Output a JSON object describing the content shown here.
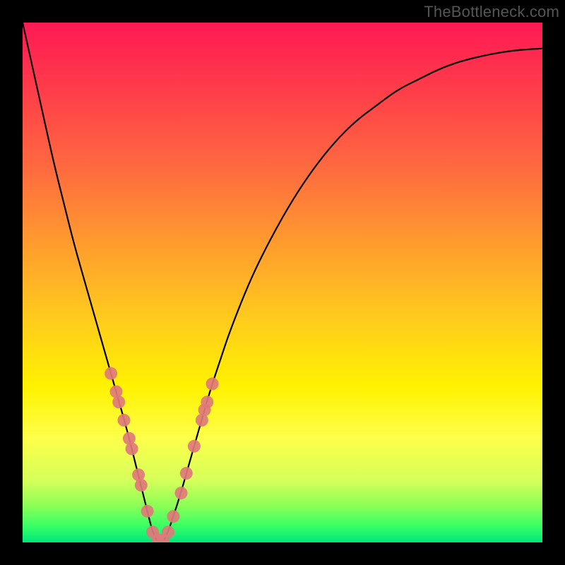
{
  "watermark": "TheBottleneck.com",
  "chart_data": {
    "type": "line",
    "title": "",
    "xlabel": "",
    "ylabel": "",
    "xlim": [
      0,
      100
    ],
    "ylim": [
      0,
      100
    ],
    "series": [
      {
        "name": "bottleneck-curve",
        "x": [
          0,
          2,
          4,
          6,
          8,
          10,
          12,
          14,
          16,
          18,
          20,
          22,
          24,
          25,
          26,
          27,
          28,
          30,
          32,
          34,
          36,
          38,
          40,
          44,
          48,
          52,
          56,
          60,
          64,
          68,
          72,
          76,
          80,
          84,
          88,
          92,
          96,
          100
        ],
        "y": [
          100,
          91,
          82,
          73,
          65,
          57,
          50,
          43,
          36,
          29,
          22,
          14,
          6,
          2,
          0,
          0,
          2,
          8,
          15,
          22,
          29,
          35,
          41,
          51,
          59,
          66,
          72,
          77,
          81,
          84,
          87,
          89,
          91,
          92.5,
          93.5,
          94.3,
          94.8,
          95
        ]
      }
    ],
    "markers": {
      "name": "curve-dots",
      "color": "#e07a7a",
      "points": [
        {
          "x": 17.0,
          "y": 32.5
        },
        {
          "x": 18.0,
          "y": 29.0
        },
        {
          "x": 18.5,
          "y": 27.0
        },
        {
          "x": 19.5,
          "y": 23.5
        },
        {
          "x": 20.5,
          "y": 20.0
        },
        {
          "x": 21.0,
          "y": 18.0
        },
        {
          "x": 22.3,
          "y": 13.0
        },
        {
          "x": 22.8,
          "y": 11.0
        },
        {
          "x": 24.0,
          "y": 6.0
        },
        {
          "x": 25.0,
          "y": 2.0
        },
        {
          "x": 26.0,
          "y": 0.5
        },
        {
          "x": 27.0,
          "y": 0.5
        },
        {
          "x": 28.0,
          "y": 2.0
        },
        {
          "x": 29.0,
          "y": 5.0
        },
        {
          "x": 30.5,
          "y": 9.5
        },
        {
          "x": 31.5,
          "y": 13.3
        },
        {
          "x": 33.0,
          "y": 18.5
        },
        {
          "x": 34.5,
          "y": 23.5
        },
        {
          "x": 35.0,
          "y": 25.5
        },
        {
          "x": 35.5,
          "y": 27.0
        },
        {
          "x": 36.5,
          "y": 30.5
        }
      ]
    }
  }
}
